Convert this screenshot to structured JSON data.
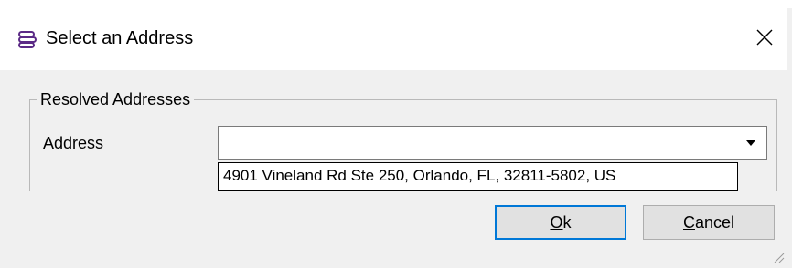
{
  "window": {
    "title": "Select an Address",
    "icon": "stacked-lines-icon",
    "close_icon": "close-icon"
  },
  "group": {
    "legend": "Resolved Addresses",
    "address_label": "Address",
    "address_value": "",
    "options": [
      "4901 Vineland Rd Ste 250, Orlando, FL, 32811-5802, US"
    ]
  },
  "buttons": {
    "ok_accel": "O",
    "ok_rest": "k",
    "cancel_accel": "C",
    "cancel_rest": "ancel"
  },
  "colors": {
    "dialog_bg": "#f0f0f0",
    "titlebar_bg": "#ffffff",
    "focus_border": "#0078d7",
    "icon_purple": "#5b2a86"
  }
}
